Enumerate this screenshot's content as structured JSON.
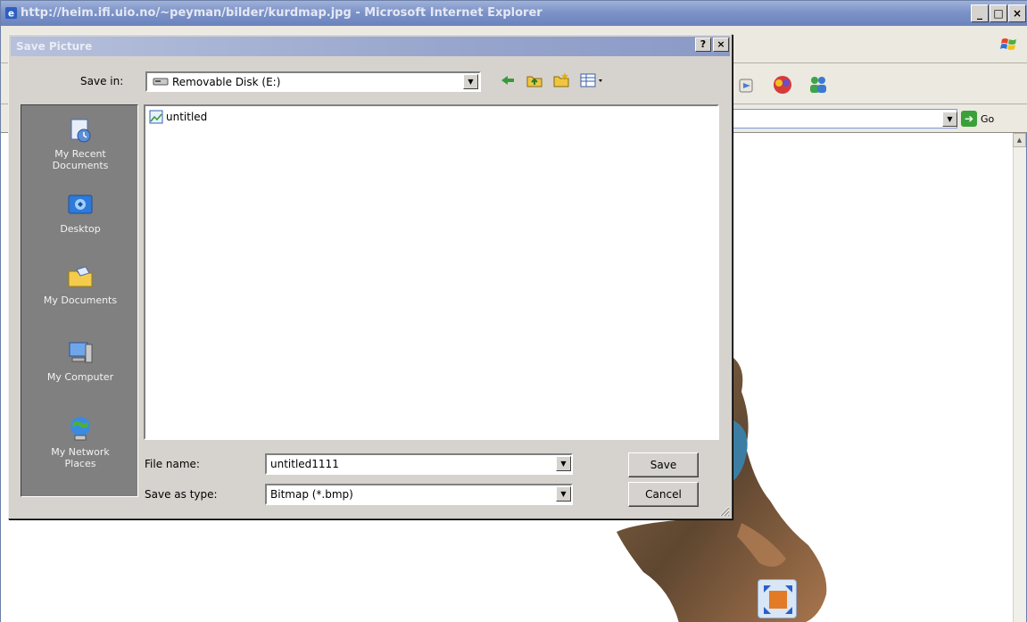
{
  "browser": {
    "title": "http://heim.ifi.uio.no/~peyman/bilder/kurdmap.jpg - Microsoft Internet Explorer",
    "caption_buttons": {
      "minimize": "_",
      "maximize": "□",
      "close": "×"
    },
    "go_label": "Go"
  },
  "dialog": {
    "title": "Save Picture",
    "help_button": "?",
    "close_button": "×",
    "save_in_label": "Save in:",
    "save_in_value": "Removable Disk (E:)",
    "places": [
      {
        "label_line1": "My Recent",
        "label_line2": "Documents",
        "icon": "recent-documents-icon"
      },
      {
        "label_line1": "Desktop",
        "label_line2": "",
        "icon": "desktop-icon"
      },
      {
        "label_line1": "My Documents",
        "label_line2": "",
        "icon": "my-documents-icon"
      },
      {
        "label_line1": "My Computer",
        "label_line2": "",
        "icon": "my-computer-icon"
      },
      {
        "label_line1": "My Network",
        "label_line2": "Places",
        "icon": "network-places-icon"
      }
    ],
    "files": [
      {
        "name": "untitled",
        "icon": "image-file-icon"
      }
    ],
    "file_name_label": "File name:",
    "file_name_value": "untitled1111",
    "save_as_type_label": "Save as type:",
    "save_as_type_value": "Bitmap (*.bmp)",
    "save_button": "Save",
    "cancel_button": "Cancel"
  }
}
